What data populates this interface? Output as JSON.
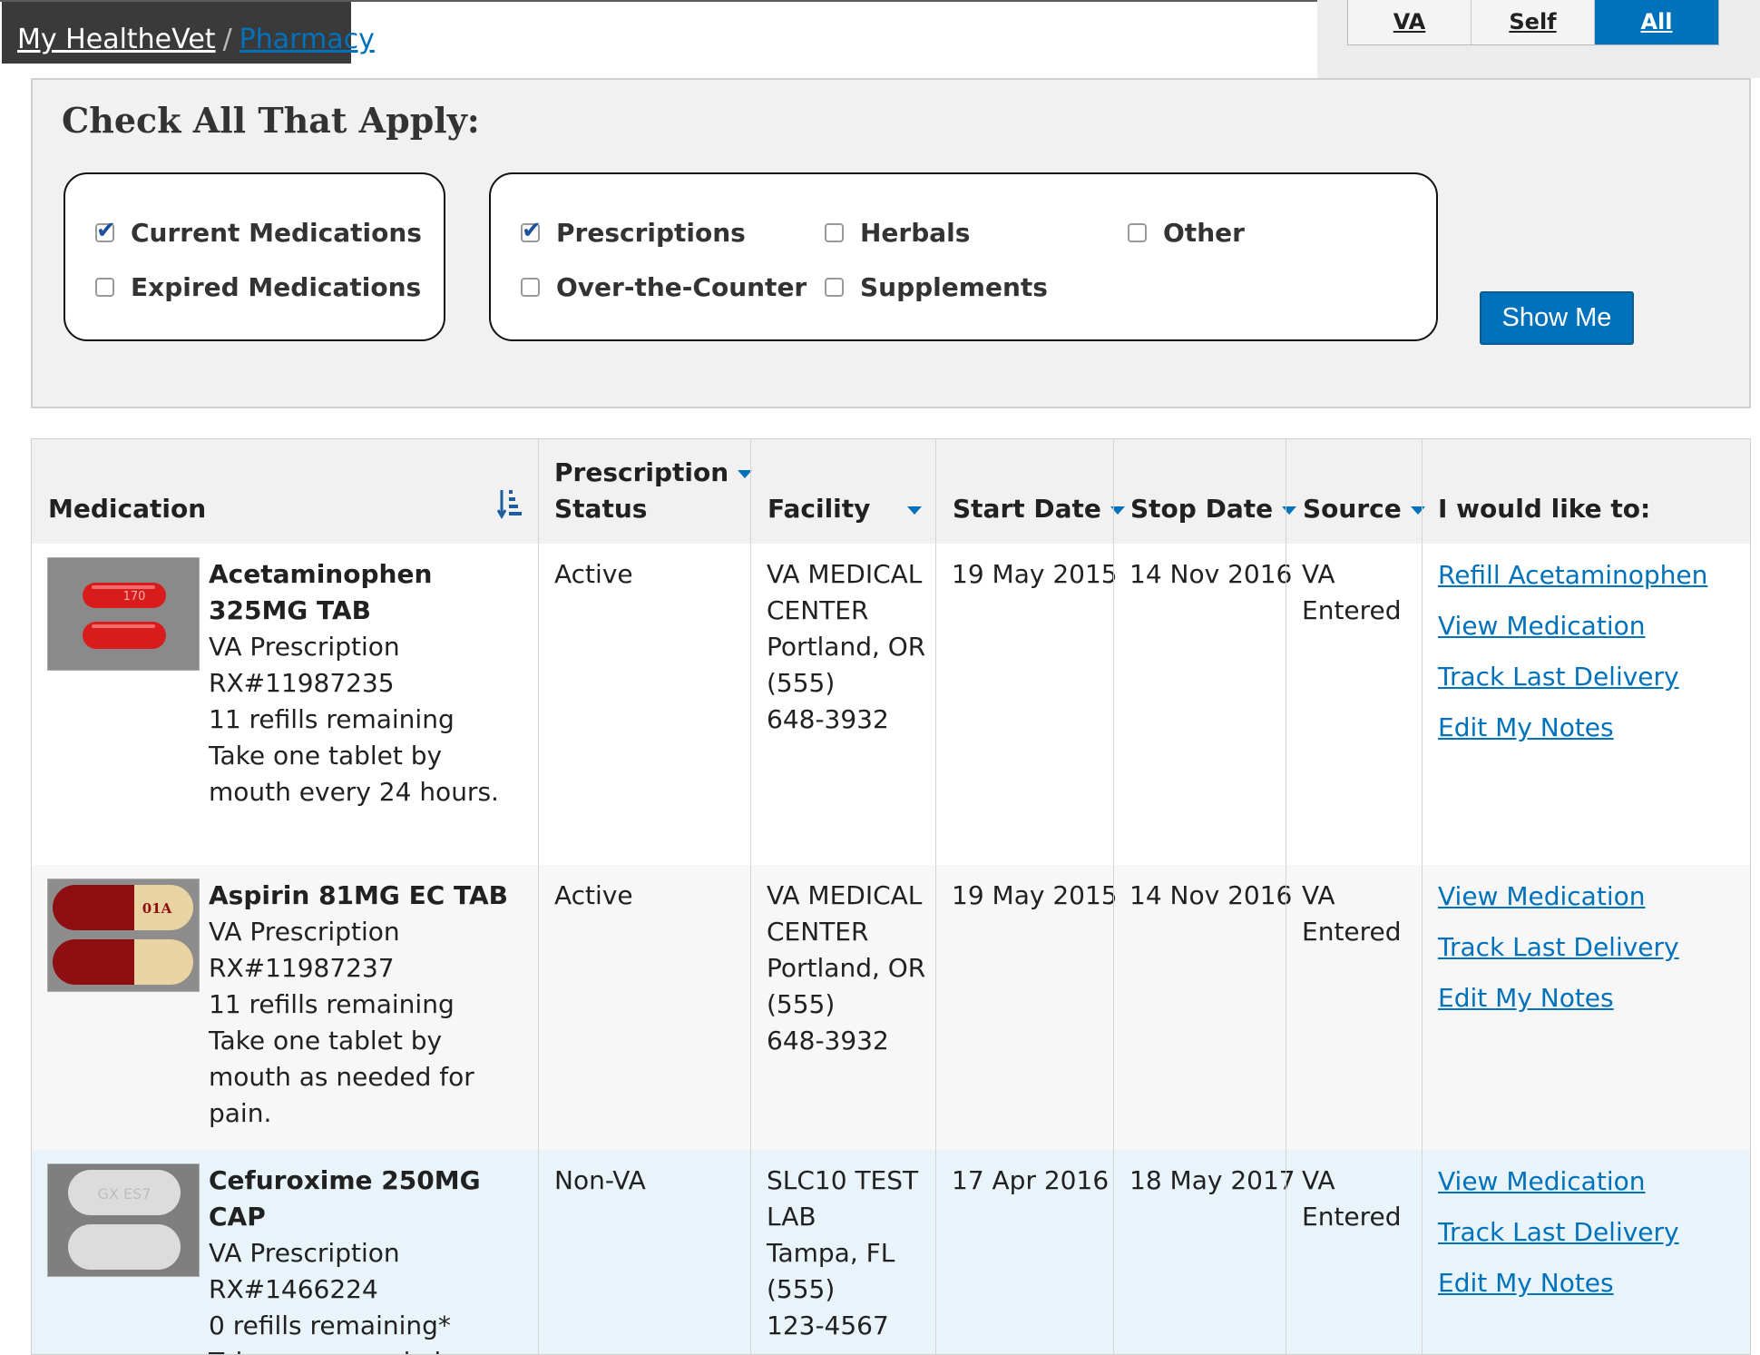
{
  "breadcrumb": {
    "home": "My HealtheVet",
    "separator": "/",
    "current": "Pharmacy"
  },
  "source_toggle": {
    "options": [
      "VA",
      "Self",
      "All"
    ],
    "selected": "All"
  },
  "filters": {
    "title": "Check All That Apply:",
    "status_group": [
      {
        "label": "Current Medications",
        "checked": true
      },
      {
        "label": "Expired Medications",
        "checked": false
      }
    ],
    "type_group": [
      {
        "label": "Prescriptions",
        "checked": true
      },
      {
        "label": "Herbals",
        "checked": false
      },
      {
        "label": "Other",
        "checked": false
      },
      {
        "label": "Over-the-Counter",
        "checked": false
      },
      {
        "label": "Supplements",
        "checked": false
      }
    ],
    "submit_label": "Show Me"
  },
  "table": {
    "headers": {
      "medication": "Medication",
      "status_line1": "Prescription",
      "status_line2": "Status",
      "facility": "Facility",
      "start": "Start Date",
      "stop": "Stop Date",
      "source": "Source",
      "actions": "I would like to:"
    },
    "rows": [
      {
        "name": "Acetaminophen 325MG TAB",
        "type": "VA Prescription",
        "rx": "RX#11987235",
        "refills": "11 refills remaining",
        "instructions": "Take one tablet by mouth every 24 hours.",
        "pill_imprint": "170",
        "status": "Active",
        "facility": [
          "VA MEDICAL",
          "CENTER",
          "Portland, OR",
          "(555)",
          "648-3932"
        ],
        "start": "19 May 2015",
        "stop": "14 Nov 2016",
        "source": [
          "VA",
          "Entered"
        ],
        "actions": [
          "Refill Acetaminophen",
          "View Medication",
          "Track Last Delivery",
          "Edit My Notes"
        ]
      },
      {
        "name": "Aspirin 81MG EC TAB",
        "type": "VA Prescription",
        "rx": "RX#11987237",
        "refills": "11 refills remaining",
        "instructions": "Take one tablet by mouth as needed for pain.",
        "pill_imprint": "01A",
        "status": "Active",
        "facility": [
          "VA MEDICAL",
          "CENTER",
          "Portland, OR",
          "(555)",
          "648-3932"
        ],
        "start": "19 May 2015",
        "stop": "14 Nov 2016",
        "source": [
          "VA",
          "Entered"
        ],
        "actions": [
          "View Medication",
          "Track Last Delivery",
          "Edit My Notes"
        ]
      },
      {
        "name": "Cefuroxime 250MG CAP",
        "type": "VA Prescription",
        "rx": "RX#1466224",
        "refills": "0 refills remaining*",
        "instructions": "Take one capsule by mouth",
        "pill_imprint": "GX ES7",
        "status": "Non-VA",
        "facility": [
          "SLC10 TEST",
          "LAB",
          "Tampa, FL",
          "(555)",
          "123-4567"
        ],
        "start": "17 Apr 2016",
        "stop": "18 May 2017",
        "source": [
          "VA",
          "Entered"
        ],
        "actions": [
          "View Medication",
          "Track Last Delivery",
          "Edit My Notes"
        ]
      }
    ]
  },
  "colors": {
    "primary": "#0071bb",
    "panel_bg": "#f1f1f1",
    "highlight_row": "#e8f4fa"
  }
}
